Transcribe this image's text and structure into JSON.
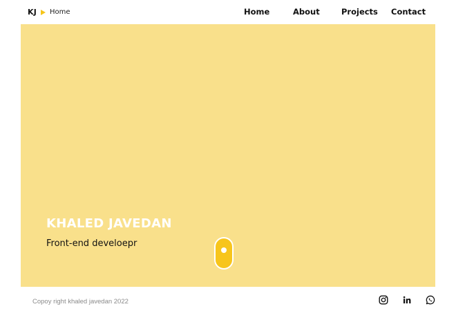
{
  "header": {
    "logo": "KJ",
    "breadcrumb": "Home",
    "nav": [
      "Home",
      "About",
      "Projects",
      "Contact"
    ]
  },
  "hero": {
    "name": "KHALED JAVEDAN",
    "role": "Front-end develoepr"
  },
  "footer": {
    "copyright": "Copoy right khaled javedan 2022",
    "social_icons": [
      "instagram-icon",
      "linkedin-icon",
      "whatsapp-icon"
    ]
  },
  "colors": {
    "accent": "#f7c51c",
    "hero_background": "#f9e08b"
  }
}
